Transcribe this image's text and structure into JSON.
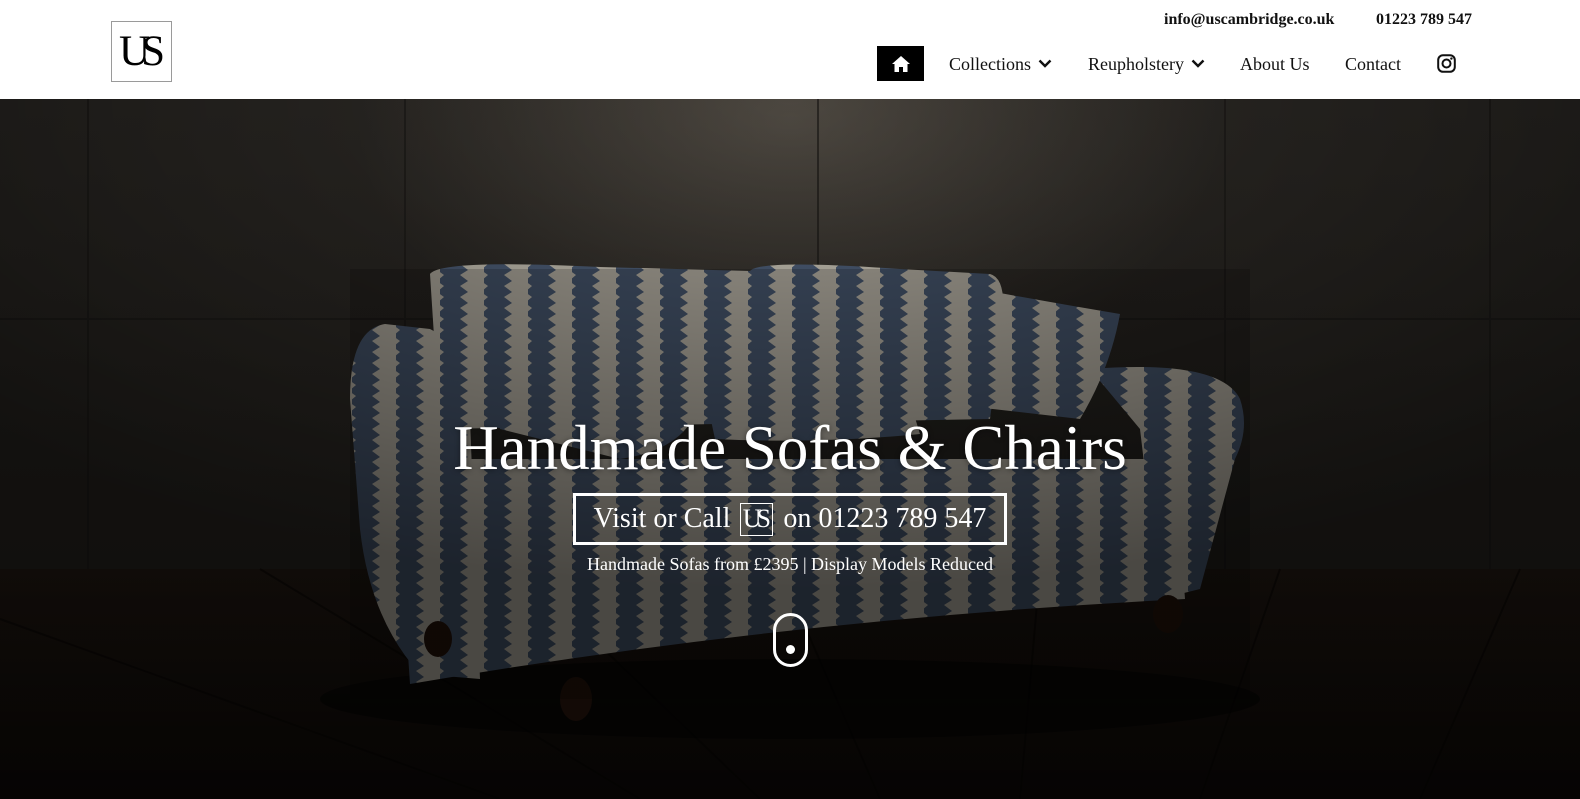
{
  "header": {
    "logo_text": "US",
    "email": "info@uscambridge.co.uk",
    "phone": "01223 789 547",
    "nav": {
      "home_icon": "home-icon",
      "collections_label": "Collections",
      "reupholstery_label": "Reupholstery",
      "about_label": "About Us",
      "contact_label": "Contact",
      "instagram_icon": "instagram-icon",
      "dropdown_icon": "chevron-down-icon"
    }
  },
  "hero": {
    "title": "Handmade Sofas & Chairs",
    "cta_prefix": "Visit or Call",
    "cta_logo": "US",
    "cta_suffix": "on 01223 789 547",
    "subtitle": "Handmade Sofas from £2395 | Display Models Reduced",
    "scroll_icon": "mouse-scroll-icon"
  },
  "colors": {
    "header_bg": "#ffffff",
    "nav_home_bg": "#000000",
    "hero_text": "#ffffff",
    "sofa_blue": "#4f6079",
    "sofa_cream": "#c9c4b6"
  }
}
